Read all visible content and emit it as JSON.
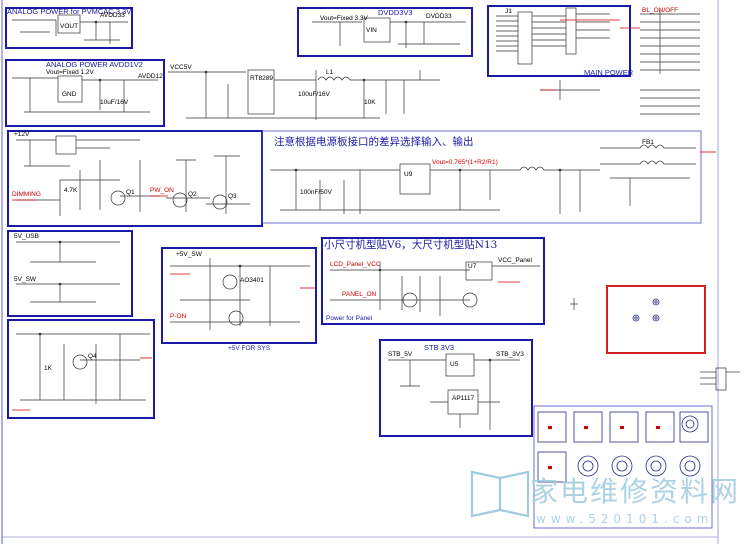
{
  "blocks": {
    "analog_power_3v3": "ANALOG POWER for PVMCAC 3.3V",
    "dvdd3v3": "DVDD3V3",
    "main_power": "MAIN POWER",
    "analog_power_avdd1v2": "ANALOG POWER AVDD1V2",
    "note_power_board": "注意根据电源板接口的差异选择输入、输出",
    "vout_formula": "Vout=0.765*(1+R2/R1)",
    "note_panel_size": "小尺寸机型贴V6，大尺寸机型贴N13",
    "power_for_panel": "Power for Panel",
    "plus5v_for_sys": "+5V FOR SYS",
    "stb_3v3": "STB 3V3"
  },
  "labels": {
    "vout_fixed_3v3": "Vout=Fixed 3.3V",
    "vout_fixed_1v2": "Vout=Fixed 1.2V",
    "avdd33": "AVDD33",
    "avdd12": "AVDD12",
    "vcc5v": "VCC5V",
    "dvdd33": "DVDD33",
    "vout": "VOUT",
    "vin": "VIN",
    "gnd": "GND",
    "bl_on_off": "BL_ON/OFF",
    "stb_5v": "STB_5V",
    "plus5v_sw": "+5V_SW",
    "plus12v": "+12V",
    "vcc_panel": "VCC_Panel",
    "stb_3v3": "STB_3V3",
    "five_v_usb": "5V_USB",
    "five_v_sw": "5V_SW",
    "u9": "U9",
    "u7": "U7",
    "u5": "U5",
    "q1": "Q1",
    "q2": "Q2",
    "q3": "Q3",
    "q4": "Q4",
    "dimming": "DIMMING",
    "lcd_panel_vcc": "LCD_Panel_VCC",
    "panel_on": "PANEL_ON",
    "pw_on": "PW_ON",
    "p_on": "P-ON",
    "rt8289": "RT8289",
    "ap1117": "AP1117",
    "mosfet": "AO3401",
    "cap_100u": "100uF/16V",
    "cap_10u": "10uF/16V",
    "cap_100n": "100nF/50V",
    "res_10k": "10K",
    "res_4k7": "4.7K",
    "res_1k": "1K",
    "ind": "L1",
    "j1": "J1",
    "ferrite": "FB1"
  },
  "watermark": {
    "brand": "家电维修资料网",
    "site": "www.520101.com"
  }
}
